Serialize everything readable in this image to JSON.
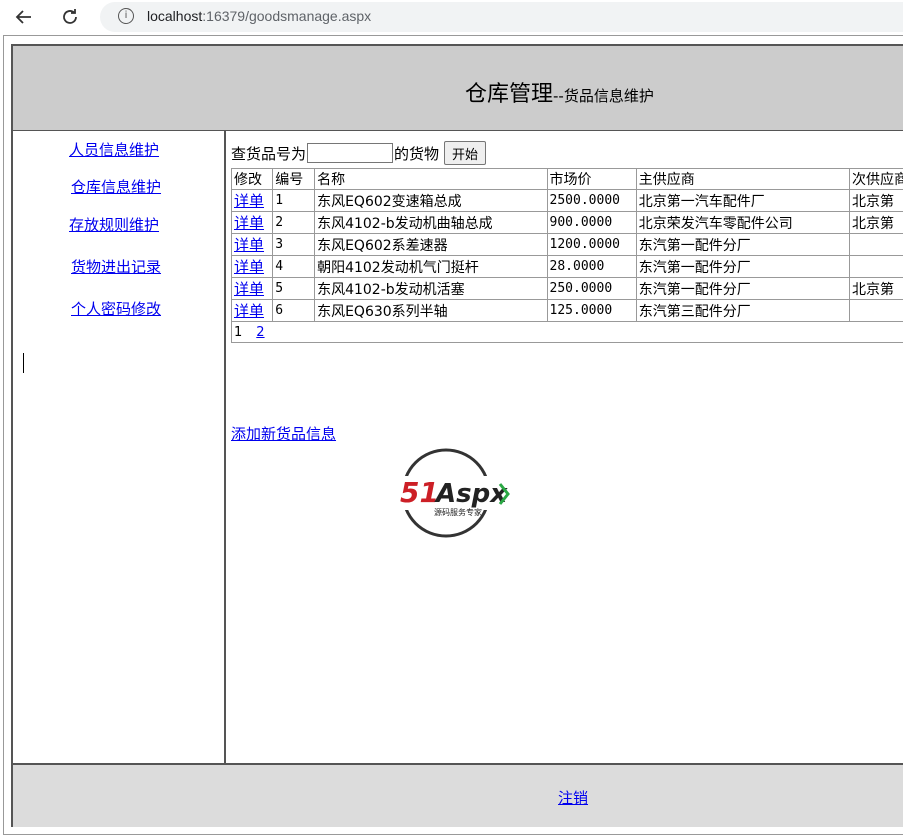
{
  "browser": {
    "url_host": "localhost",
    "url_rest": ":16379/goodsmanage.aspx"
  },
  "header": {
    "title_main": "仓库管理",
    "title_sub": "--货品信息维护"
  },
  "sidebar": {
    "items": [
      {
        "label": "人员信息维护"
      },
      {
        "label": "仓库信息维护"
      },
      {
        "label": "存放规则维护"
      },
      {
        "label": "货物进出记录"
      },
      {
        "label": "个人密码修改"
      }
    ]
  },
  "search": {
    "prefix": "查货品号为",
    "suffix": "的货物",
    "value": "",
    "button_label": "开始"
  },
  "table": {
    "headers": [
      "修改",
      "编号",
      "名称",
      "市场价",
      "主供应商",
      "次供应商"
    ],
    "rows": [
      {
        "action": "详单",
        "id": "1",
        "name": "东风EQ602变速箱总成",
        "price": "2500.0000",
        "main_supplier": "北京第一汽车配件厂",
        "second_supplier": "北京第"
      },
      {
        "action": "详单",
        "id": "2",
        "name": "东风4102-b发动机曲轴总成",
        "price": "900.0000",
        "main_supplier": "北京荣发汽车零配件公司",
        "second_supplier": "北京第"
      },
      {
        "action": "详单",
        "id": "3",
        "name": "东风EQ602系差速器",
        "price": "1200.0000",
        "main_supplier": "东汽第一配件分厂",
        "second_supplier": ""
      },
      {
        "action": "详单",
        "id": "4",
        "name": "朝阳4102发动机气门挺杆",
        "price": "28.0000",
        "main_supplier": "东汽第一配件分厂",
        "second_supplier": ""
      },
      {
        "action": "详单",
        "id": "5",
        "name": "东风4102-b发动机活塞",
        "price": "250.0000",
        "main_supplier": "东汽第一配件分厂",
        "second_supplier": "北京第"
      },
      {
        "action": "详单",
        "id": "6",
        "name": "东风EQ630系列半轴",
        "price": "125.0000",
        "main_supplier": "东汽第三配件分厂",
        "second_supplier": ""
      }
    ],
    "pager": {
      "current": "1",
      "next": "2"
    }
  },
  "add_link": "添加新货品信息",
  "logo": {
    "text_main": "51Aspx",
    "text_sub": "源码服务专家"
  },
  "footer": {
    "logout_label": "注销"
  }
}
